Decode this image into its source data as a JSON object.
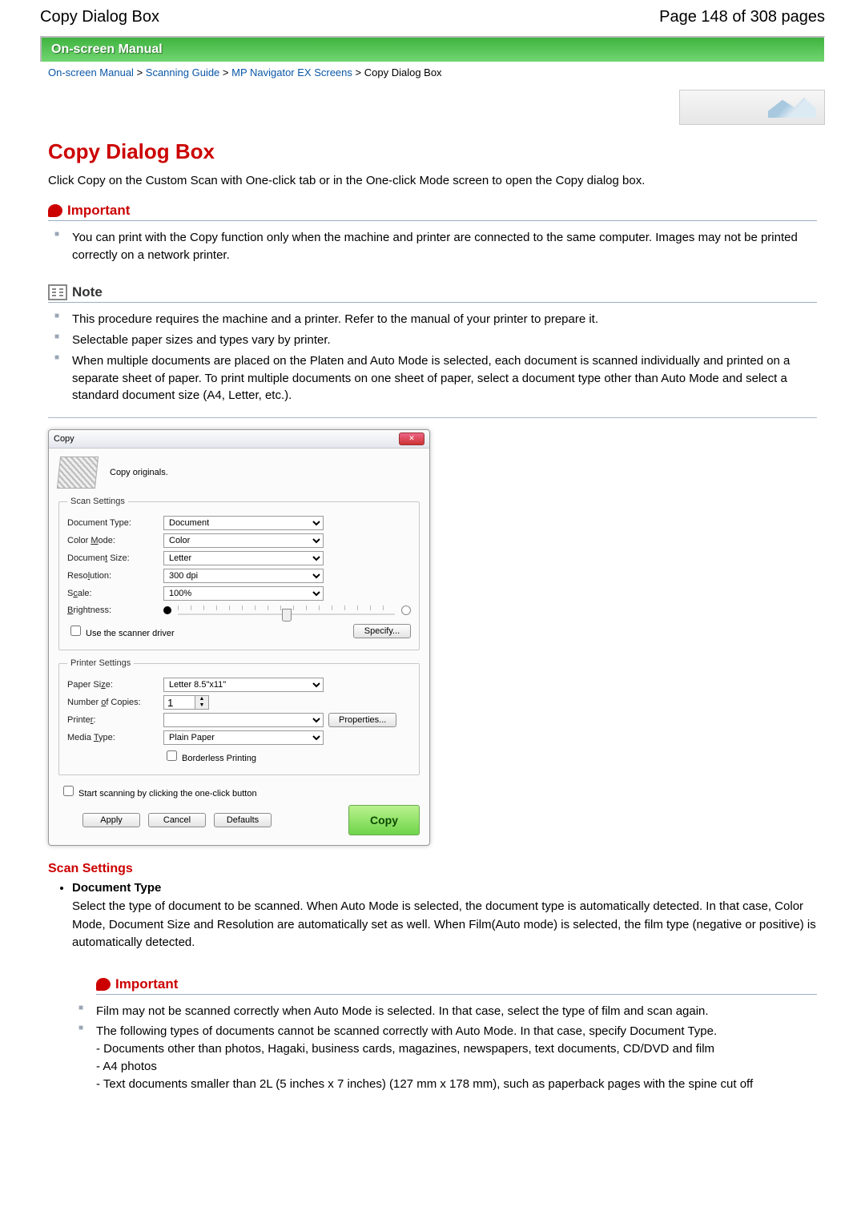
{
  "header": {
    "title_left": "Copy Dialog Box",
    "title_right": "Page 148 of 308 pages"
  },
  "manual_bar": "On-screen Manual",
  "breadcrumb": {
    "items": [
      "On-screen Manual",
      "Scanning Guide",
      "MP Navigator EX Screens"
    ],
    "sep": " > ",
    "current": "Copy Dialog Box"
  },
  "page_title": "Copy Dialog Box",
  "intro": "Click Copy on the Custom Scan with One-click tab or in the One-click Mode screen to open the Copy dialog box.",
  "important_label": "Important",
  "important1": {
    "items": [
      "You can print with the Copy function only when the machine and printer are connected to the same computer. Images may not be printed correctly on a network printer."
    ]
  },
  "note_label": "Note",
  "note1": {
    "items": [
      "This procedure requires the machine and a printer. Refer to the manual of your printer to prepare it.",
      "Selectable paper sizes and types vary by printer.",
      "When multiple documents are placed on the Platen and Auto Mode is selected, each document is scanned individually and printed on a separate sheet of paper. To print multiple documents on one sheet of paper, select a document type other than Auto Mode and select a standard document size (A4, Letter, etc.)."
    ]
  },
  "dialog": {
    "title": "Copy",
    "subtitle": "Copy originals.",
    "scan_legend": "Scan Settings",
    "printer_legend": "Printer Settings",
    "labels": {
      "doc_type": "Document Type:",
      "color_mode_pre": "Color ",
      "color_mode_u": "M",
      "color_mode_post": "ode:",
      "doc_size_pre": "Documen",
      "doc_size_u": "t",
      "doc_size_post": " Size:",
      "res_pre": "Reso",
      "res_u": "l",
      "res_post": "ution:",
      "scale_pre": "S",
      "scale_u": "c",
      "scale_post": "ale:",
      "brightness_pre": "",
      "brightness_u": "B",
      "brightness_post": "rightness:",
      "use_driver_pre": "Use the scanner dri",
      "use_driver_u": "v",
      "use_driver_post": "er",
      "specify_pre": "Speci",
      "specify_u": "f",
      "specify_post": "y...",
      "paper_size_pre": "Paper Si",
      "paper_size_u": "z",
      "paper_size_post": "e:",
      "copies_pre": "Number ",
      "copies_u": "o",
      "copies_post": "f Copies:",
      "printer_pre": "Printe",
      "printer_u": "r",
      "printer_post": ":",
      "properties_pre": "Propert",
      "properties_u": "i",
      "properties_post": "es...",
      "media_pre": "Media ",
      "media_u": "T",
      "media_post": "ype:",
      "borderless": "Borderless Printing",
      "start_one_click_pre": "Start scanning by cl",
      "start_one_click_u": "i",
      "start_one_click_post": "cking the one-click button",
      "apply_u": "A",
      "apply_post": "pply",
      "cancel": "Cancel",
      "defaults_u": "D",
      "defaults_post": "efaults",
      "copy_btn": "Copy"
    },
    "values": {
      "doc_type": "Document",
      "color_mode": "Color",
      "doc_size": "Letter",
      "resolution": "300 dpi",
      "scale": "100%",
      "paper_size": "Letter 8.5\"x11\"",
      "copies": "1",
      "printer": "",
      "media": "Plain Paper"
    }
  },
  "scan_settings_head": "Scan Settings",
  "doc_type_item": {
    "title": "Document Type",
    "desc": "Select the type of document to be scanned. When Auto Mode is selected, the document type is automatically detected. In that case, Color Mode, Document Size and Resolution are automatically set as well. When Film(Auto mode) is selected, the film type (negative or positive) is automatically detected."
  },
  "important2": {
    "items": [
      "Film may not be scanned correctly when Auto Mode is selected. In that case, select the type of film and scan again.",
      "The following types of documents cannot be scanned correctly with Auto Mode. In that case, specify Document Type."
    ],
    "sub": [
      "- Documents other than photos, Hagaki, business cards, magazines, newspapers, text documents, CD/DVD and film",
      "- A4 photos",
      "- Text documents smaller than 2L (5 inches x 7 inches) (127 mm x 178 mm), such as paperback pages with the spine cut off"
    ]
  }
}
